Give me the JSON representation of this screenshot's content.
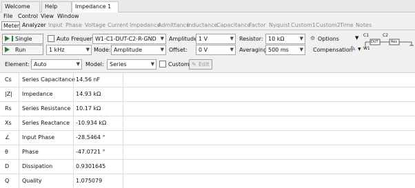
{
  "doc_tabs": {
    "welcome": "Welcome",
    "help": "Help",
    "impedance": "Impedance 1"
  },
  "menu": [
    "File",
    "Control",
    "View",
    "Window"
  ],
  "tabs": [
    "Meter",
    "Analyzer",
    "Input",
    "Phase",
    "Voltage",
    "Current",
    "Impedance",
    "Admittance",
    "Inductance",
    "Capacitance",
    "Factor",
    "Nyquist",
    "Custom1",
    "Custom2",
    "Time",
    "Notes"
  ],
  "controls": {
    "single_label": "Single",
    "run_label": "Run",
    "auto_frequency_label": "Auto Frequency",
    "circuit_value": "W1-C1-DUT-C2-R-GND",
    "frequency_value": "1 kHz",
    "mode_label": "Mode:",
    "mode_value": "Amplitude",
    "amplitude_label": "Amplitude:",
    "amplitude_value": "1 V",
    "offset_label": "Offset:",
    "offset_value": "0 V",
    "resistor_label": "Resistor:",
    "resistor_value": "10 kΩ",
    "averaging_label": "Averaging:",
    "averaging_value": "500 ms",
    "options_label": "Options",
    "compensation_label": "Compensation",
    "diagram_c1": "C1",
    "diagram_c2": "C2",
    "diagram_w1": "W1",
    "diagram_dut": "DUT",
    "diagram_res": "Res"
  },
  "element_row": {
    "element_label": "Element:",
    "element_value": "Auto",
    "model_label": "Model:",
    "model_value": "Series",
    "custom_label": "Custom",
    "edit_label": "Edit"
  },
  "rows": [
    {
      "symbol": "Cs",
      "name": "Series Capacitance",
      "value": "14.56 nF"
    },
    {
      "symbol": "|Z|",
      "name": "Impedance",
      "value": "14.93 kΩ"
    },
    {
      "symbol": "Rs",
      "name": "Series Resistance",
      "value": "10.17 kΩ"
    },
    {
      "symbol": "Xs",
      "name": "Series Reactance",
      "value": "-10.934 kΩ"
    },
    {
      "symbol": "∠",
      "name": "Input Phase",
      "value": "-28.5464 °"
    },
    {
      "symbol": "θ",
      "name": "Phase",
      "value": "-47.0721 °"
    },
    {
      "symbol": "D",
      "name": "Dissipation",
      "value": "0.9301645"
    },
    {
      "symbol": "Q",
      "name": "Quality",
      "value": "1.075079"
    }
  ]
}
